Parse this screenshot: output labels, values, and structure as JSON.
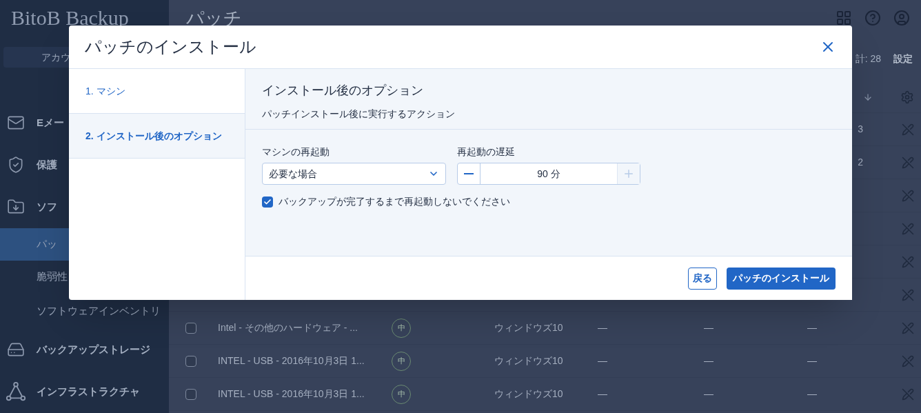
{
  "app": {
    "logo": "BitoB Backup",
    "account_button": "アカウ"
  },
  "sidebar": {
    "items": [
      {
        "label": "Eメー",
        "kind": "main",
        "selected": false
      },
      {
        "label": "保護",
        "kind": "main",
        "selected": false
      },
      {
        "label": "ソフ",
        "kind": "main",
        "selected": false
      },
      {
        "label": "パッ",
        "kind": "sub",
        "selected": true
      },
      {
        "label": "脆弱性",
        "kind": "sub",
        "selected": false
      },
      {
        "label": "ソフトウェアインベントリ",
        "kind": "sub",
        "selected": false
      },
      {
        "label": "バックアップストレージ",
        "kind": "main",
        "selected": false
      },
      {
        "label": "インフラストラクチャ",
        "kind": "main",
        "selected": false
      }
    ]
  },
  "page": {
    "title": "パッチ",
    "total": "計: 28",
    "settings_link": "設定"
  },
  "table": {
    "partial_rows": [
      {
        "column_1": "3"
      },
      {
        "column_1": "2"
      },
      {},
      {},
      {},
      {}
    ],
    "rows": [
      {
        "checked": false,
        "name": "Intel - その他のハードウェア - ...",
        "severity": "中",
        "os": "ウィンドウズ10",
        "column_4": "—",
        "column_5": "—",
        "column_6": "—"
      },
      {
        "checked": false,
        "name": "INTEL - USB - 2016年10月3日 1...",
        "severity": "中",
        "os": "ウィンドウズ10",
        "column_4": "—",
        "column_5": "—",
        "column_6": "—"
      },
      {
        "checked": false,
        "name": "INTEL - USB - 2016年10月3日 1...",
        "severity": "中",
        "os": "ウィンドウズ10",
        "column_4": "—",
        "column_5": "—",
        "column_6": "—"
      }
    ]
  },
  "dialog": {
    "title": "パッチのインストール",
    "steps": [
      {
        "label": "1. マシン",
        "selected": false
      },
      {
        "label": "2. インストール後のオプション",
        "selected": true
      }
    ],
    "section_title": "インストール後のオプション",
    "section_subtitle": "パッチインストール後に実行するアクション",
    "restart": {
      "label": "マシンの再起動",
      "value": "必要な場合"
    },
    "delay": {
      "label": "再起動の遅延",
      "value": "90 分",
      "minus_disabled": false,
      "plus_disabled": true
    },
    "wait_backup": {
      "label": "バックアップが完了するまで再起動しないでください",
      "checked": true
    },
    "back_button": "戻る",
    "install_button": "パッチのインストール"
  }
}
